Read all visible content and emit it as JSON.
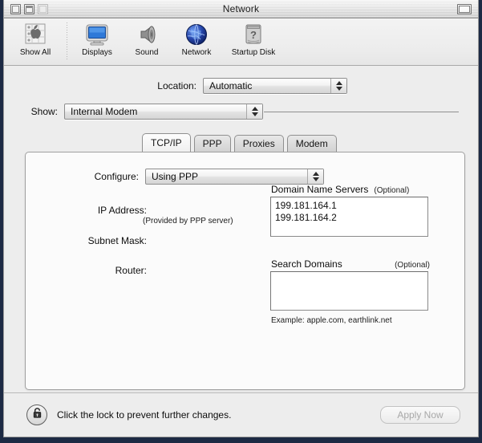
{
  "window": {
    "title": "Network",
    "controls": {
      "close": "close-box",
      "minimize": "collapse-box",
      "zoom": "zoom-box",
      "right_collapse": "windowshade-box"
    }
  },
  "toolbar": {
    "items": [
      {
        "label": "Show All",
        "icon": "apple-grid-icon"
      },
      {
        "label": "Displays",
        "icon": "display-monitor-icon"
      },
      {
        "label": "Sound",
        "icon": "speaker-icon"
      },
      {
        "label": "Network",
        "icon": "globe-icon"
      },
      {
        "label": "Startup Disk",
        "icon": "hard-disk-question-icon"
      }
    ]
  },
  "location": {
    "label": "Location:",
    "value": "Automatic"
  },
  "show": {
    "label": "Show:",
    "value": "Internal Modem"
  },
  "tabs": [
    {
      "label": "TCP/IP",
      "selected": true
    },
    {
      "label": "PPP",
      "selected": false
    },
    {
      "label": "Proxies",
      "selected": false
    },
    {
      "label": "Modem",
      "selected": false
    }
  ],
  "tcpip": {
    "configure": {
      "label": "Configure:",
      "value": "Using PPP"
    },
    "ip_address": {
      "label": "IP Address:",
      "value": "",
      "note": "(Provided by PPP server)"
    },
    "subnet_mask": {
      "label": "Subnet Mask:",
      "value": ""
    },
    "router": {
      "label": "Router:",
      "value": ""
    },
    "dns": {
      "title": "Domain Name Servers",
      "optional": "(Optional)",
      "value": "199.181.164.1\n199.181.164.2",
      "line1": "199.181.164.1",
      "line2": "199.181.164.2"
    },
    "search_domains": {
      "title": "Search Domains",
      "optional": "(Optional)",
      "value": "",
      "example": "Example: apple.com, earthlink.net"
    }
  },
  "bottom": {
    "lock_icon": "padlock-unlocked-icon",
    "lock_text": "Click the lock to prevent further changes.",
    "apply_label": "Apply Now",
    "apply_enabled": false
  },
  "colors": {
    "desktop": "#1d2a44",
    "window_bg": "#ededed",
    "panel_bg": "#fbfbfb",
    "field_bg": "#ffffff",
    "accent_globe": "#1d3fa0"
  }
}
